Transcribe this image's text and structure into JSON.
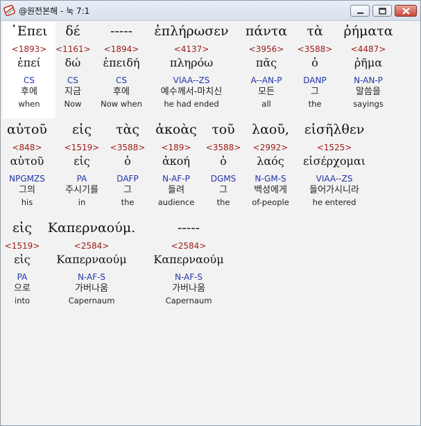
{
  "window": {
    "title": "@원전본해 - 눅 7:1",
    "icons": {
      "app": "book-scroll-icon",
      "minimize": "minimize-icon",
      "maximize": "maximize-icon",
      "close": "close-icon"
    }
  },
  "verse": [
    {
      "greek": "᾿Επει",
      "strongs": "<1893>",
      "lemma": "ἐπεί",
      "parse": "CS",
      "korean": "후에",
      "english": "when"
    },
    {
      "greek": "δέ",
      "strongs": "<1161>",
      "lemma": "δώ",
      "parse": "CS",
      "korean": "지금",
      "english": "Now"
    },
    {
      "greek": "-----",
      "strongs": "<1894>",
      "lemma": "ἐπειδή",
      "parse": "CS",
      "korean": "후에",
      "english": "Now when"
    },
    {
      "greek": "ἐπλήρωσεν",
      "strongs": "<4137>",
      "lemma": "πληρόω",
      "parse": "VIAA--ZS",
      "korean": "예수께서-마치신",
      "english": "he had ended"
    },
    {
      "greek": "πάντα",
      "strongs": "<3956>",
      "lemma": "πᾶς",
      "parse": "A--AN-P",
      "korean": "모든",
      "english": "all"
    },
    {
      "greek": "τὰ",
      "strongs": "<3588>",
      "lemma": "ὁ",
      "parse": "DANP",
      "korean": "그",
      "english": "the"
    },
    {
      "greek": "ῥήματα",
      "strongs": "<4487>",
      "lemma": "ῥῆμα",
      "parse": "N-AN-P",
      "korean": "말씀을",
      "english": "sayings"
    },
    {
      "greek": "αὐτοῦ",
      "strongs": "<848>",
      "lemma": "αὑτοῦ",
      "parse": "NPGMZS",
      "korean": "그의",
      "english": "his"
    },
    {
      "greek": "εἰς",
      "strongs": "<1519>",
      "lemma": "εἰς",
      "parse": "PA",
      "korean": "주시기를",
      "english": "in"
    },
    {
      "greek": "τὰς",
      "strongs": "<3588>",
      "lemma": "ὁ",
      "parse": "DAFP",
      "korean": "그",
      "english": "the"
    },
    {
      "greek": "ἀκοὰς",
      "strongs": "<189>",
      "lemma": "ἀκοή",
      "parse": "N-AF-P",
      "korean": "들려",
      "english": "audience"
    },
    {
      "greek": "τοῦ",
      "strongs": "<3588>",
      "lemma": "ὁ",
      "parse": "DGMS",
      "korean": "그",
      "english": "the"
    },
    {
      "greek": "λαοῦ,",
      "strongs": "<2992>",
      "lemma": "λαός",
      "parse": "N-GM-S",
      "korean": "백성에게",
      "english": "of-people"
    },
    {
      "greek": "εἰσῆλθεν",
      "strongs": "<1525>",
      "lemma": "εἰσέρχομαι",
      "parse": "VIAA--ZS",
      "korean": "들어가시니라",
      "english": "he entered"
    },
    {
      "greek": "εἰς",
      "strongs": "<1519>",
      "lemma": "εἰς",
      "parse": "PA",
      "korean": "으로",
      "english": "into"
    },
    {
      "greek": "Καπερναούμ.",
      "strongs": "<2584>",
      "lemma": "Καπερναούμ",
      "parse": "N-AF-S",
      "korean": "가버나움",
      "english": "Capernaum"
    },
    {
      "greek": "-----",
      "strongs": "<2584>",
      "lemma": "Καπερναούμ",
      "parse": "N-AF-S",
      "korean": "가버나움",
      "english": "Capernaum"
    }
  ]
}
